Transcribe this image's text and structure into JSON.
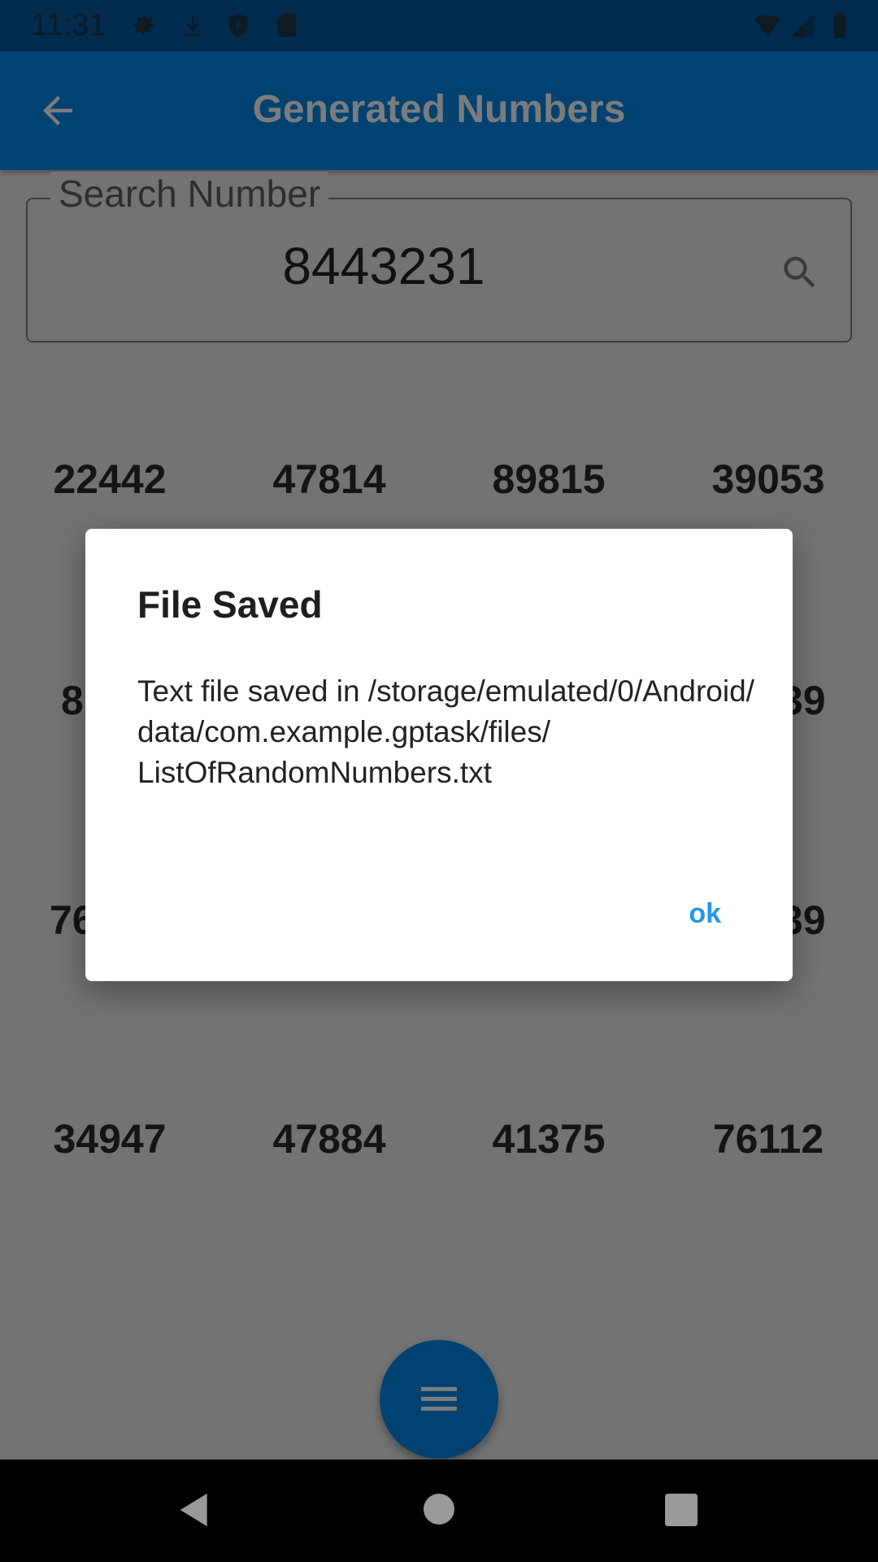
{
  "status_bar": {
    "time": "11:31",
    "icons_left": [
      "gear-icon",
      "download-icon",
      "shield-play-icon",
      "sd-card-icon"
    ],
    "icons_right": [
      "wifi-icon",
      "signal-icon",
      "battery-icon"
    ]
  },
  "app_bar": {
    "title": "Generated Numbers",
    "back_icon": "arrow-back-icon"
  },
  "search": {
    "label": "Search Number",
    "value": "8443231",
    "icon": "search-icon"
  },
  "numbers": {
    "row1": [
      "22442",
      "47814",
      "89815",
      "39053"
    ],
    "row2_visible": {
      "first": "8",
      "last": "39"
    },
    "row3_visible": {
      "first": "76",
      "last": "39"
    },
    "row4": [
      "34947",
      "47884",
      "41375",
      "76112"
    ]
  },
  "dialog": {
    "title": "File Saved",
    "message": "Text file saved in /storage/emulated/0/Android/data/com.example.gptask/files/ListOfRandomNumbers.txt",
    "ok_label": "ok",
    "accent": "#2196f3"
  },
  "fab": {
    "icon": "menu-icon",
    "color": "#004272"
  },
  "nav_bar": {
    "icons": [
      "back-triangle-icon",
      "home-circle-icon",
      "recents-square-icon"
    ]
  }
}
